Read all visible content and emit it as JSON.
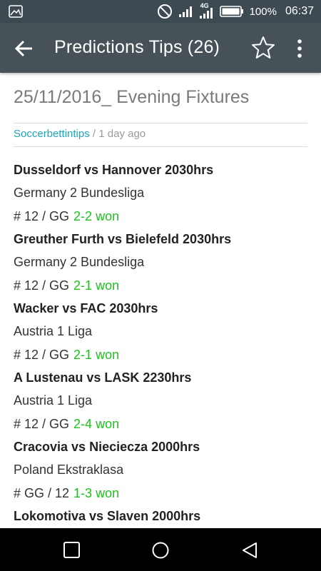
{
  "status_bar": {
    "network": "4G",
    "battery": "100%",
    "time": "06:37"
  },
  "app_bar": {
    "title": "Predictions Tips (26)"
  },
  "post": {
    "title": "25/11/2016_ Evening Fixtures",
    "author": "Soccerbettintips",
    "separator": " / ",
    "time_ago": "1 day ago"
  },
  "fixtures": [
    {
      "match": "Dusseldorf vs Hannover 2030hrs",
      "league": "Germany 2 Bundesliga",
      "tip": "# 12 / GG",
      "result": "2-2 won"
    },
    {
      "match": "Greuther Furth vs Bielefeld 2030hrs",
      "league": "Germany 2 Bundesliga",
      "tip": "# 12 / GG",
      "result": "2-1 won"
    },
    {
      "match": "Wacker vs FAC 2030hrs",
      "league": "Austria 1 Liga",
      "tip": "# 12 / GG",
      "result": "2-1 won"
    },
    {
      "match": "A Lustenau vs LASK 2230hrs",
      "league": "Austria 1 Liga",
      "tip": "# 12 / GG",
      "result": "2-4 won"
    },
    {
      "match": "Cracovia vs Nieciecza 2000hrs",
      "league": "Poland Ekstraklasa",
      "tip": "# GG / 12",
      "result": "1-3 won"
    },
    {
      "match": "Lokomotiva vs Slaven 2000hrs",
      "league": "",
      "tip": "",
      "result": ""
    }
  ],
  "colors": {
    "status_bar": "#3d4a51",
    "app_bar": "#465257",
    "author_link": "#20a4b8",
    "result_won": "#1ec21e"
  },
  "icons": {
    "status_left": "image-icon",
    "dnd": "do-not-disturb-icon",
    "back": "arrow-back-icon",
    "favorite": "star-outline-icon",
    "menu": "more-vert-icon",
    "nav_recent": "square-icon",
    "nav_home": "circle-icon",
    "nav_back": "triangle-back-icon"
  }
}
